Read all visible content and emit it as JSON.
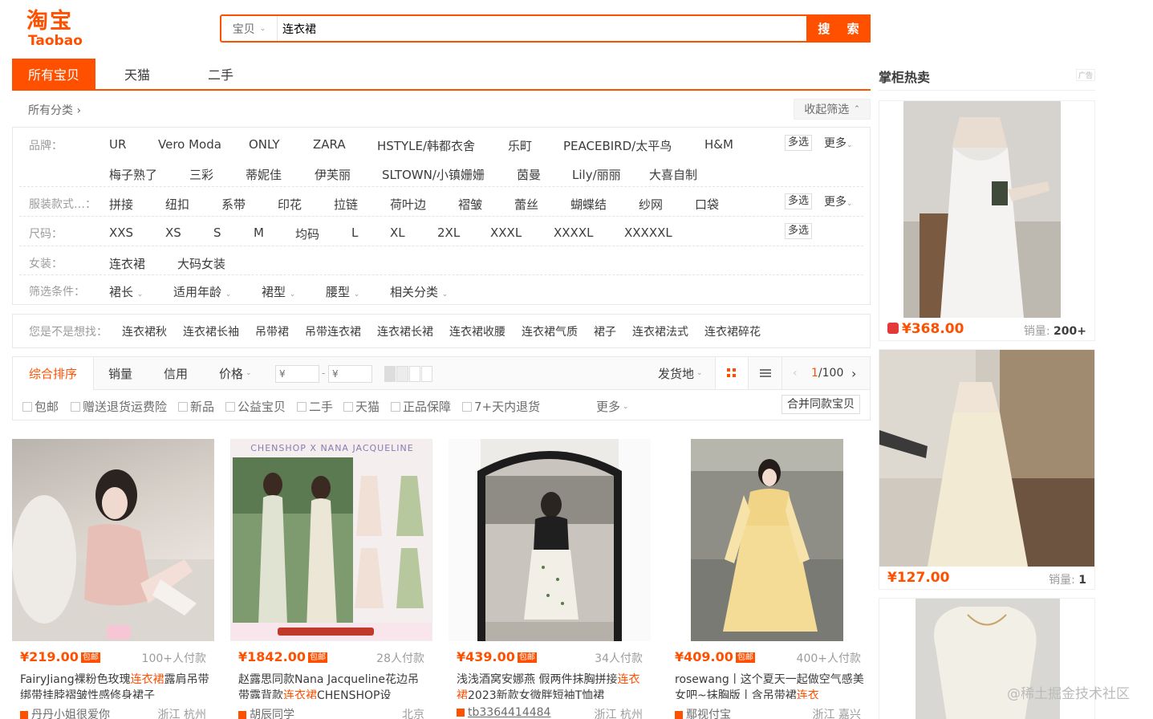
{
  "header": {
    "logo_cn": "淘宝",
    "logo_en": "Taobao",
    "search_scope": "宝贝",
    "search_value": "连衣裙",
    "search_button": "搜 索"
  },
  "tabs": [
    {
      "label": "所有宝贝",
      "active": true
    },
    {
      "label": "天猫"
    },
    {
      "label": "二手"
    }
  ],
  "breadcrumb": "所有分类 ›",
  "collapse_label": "收起筛选",
  "filters": {
    "brand": {
      "label": "品牌：",
      "row1": [
        "UR",
        "Vero Moda",
        "ONLY",
        "ZARA",
        "HSTYLE/韩都衣舍",
        "乐町",
        "PEACEBIRD/太平鸟",
        "H&M"
      ],
      "row2": [
        "梅子熟了",
        "三彩",
        "蒂妮佳",
        "伊芙丽",
        "SLTOWN/小镇姗姗",
        "茵曼",
        "Lily/丽丽",
        "大喜自制"
      ]
    },
    "style": {
      "label": "服装款式…：",
      "items": [
        "拼接",
        "纽扣",
        "系带",
        "印花",
        "拉链",
        "荷叶边",
        "褶皱",
        "蕾丝",
        "蝴蝶结",
        "纱网",
        "口袋"
      ]
    },
    "size": {
      "label": "尺码：",
      "items": [
        "XXS",
        "XS",
        "S",
        "M",
        "均码",
        "L",
        "XL",
        "2XL",
        "XXXL",
        "XXXXL",
        "XXXXXL"
      ]
    },
    "women": {
      "label": "女装：",
      "items": [
        "连衣裙",
        "大码女装"
      ]
    },
    "conditions": {
      "label": "筛选条件：",
      "items": [
        "裙长",
        "适用年龄",
        "裙型",
        "腰型",
        "相关分类"
      ]
    },
    "multi_label": "多选",
    "more_label": "更多"
  },
  "guess": {
    "label": "您是不是想找：",
    "items": [
      "连衣裙秋",
      "连衣裙长袖",
      "吊带裙",
      "吊带连衣裙",
      "连衣裙长裙",
      "连衣裙收腰",
      "连衣裙气质",
      "裙子",
      "连衣裙法式",
      "连衣裙碎花"
    ]
  },
  "sort": {
    "items": [
      "综合排序",
      "销量",
      "信用",
      "价格"
    ],
    "price_from": "¥",
    "price_to": "¥",
    "dash": "-",
    "ship_from": "发货地",
    "page_current": "1",
    "page_total": "/100"
  },
  "options": [
    "包邮",
    "赠送退货运费险",
    "新品",
    "公益宝贝",
    "二手",
    "天猫",
    "正品保障",
    "7+天内退货"
  ],
  "options_more": "更多",
  "merge_label": "合并同款宝贝",
  "products": [
    {
      "price": "¥219.00",
      "tag": "包邮",
      "paid": "100+人付款",
      "title_pre": "FairyJiang裸粉色玫瑰",
      "title_hl": "连衣裙",
      "title_post": "露肩吊带绑带挂脖褶皱性感修身裙子",
      "shop": "丹丹小姐很爱你",
      "loc": "浙江 杭州"
    },
    {
      "price": "¥1842.00",
      "tag": "包邮",
      "paid": "28人付款",
      "title_pre": "赵露思同款Nana Jacqueline花边吊带露背款",
      "title_hl": "连衣裙",
      "title_post": "CHENSHOP设",
      "shop": "胡辰同学",
      "loc": "北京",
      "banner": "CHENSHOP X NANA JACQUELINE"
    },
    {
      "price": "¥439.00",
      "tag": "包邮",
      "paid": "34人付款",
      "title_pre": "浅浅酒窝安娜燕 假两件抹胸拼接",
      "title_hl": "连衣裙",
      "title_post": "2023新款女微胖短袖T恤裙",
      "shop": "tb3364414484",
      "loc": "浙江 杭州"
    },
    {
      "price": "¥409.00",
      "tag": "包邮",
      "paid": "400+人付款",
      "title_pre": "rosewang丨这个夏天一起做空气感美女吧~抹胸版丨含吊带裙",
      "title_hl": "连衣",
      "title_post": "",
      "shop": "鄢视付宝",
      "loc": "浙江 嘉兴"
    }
  ],
  "right": {
    "title": "掌柜热卖",
    "ad": "广告",
    "items": [
      {
        "price": "¥368.00",
        "sales_label": "销量: ",
        "sales": "200+"
      },
      {
        "price": "¥127.00",
        "sales_label": "销量: ",
        "sales": "1"
      }
    ]
  },
  "watermark": "@稀土掘金技术社区"
}
